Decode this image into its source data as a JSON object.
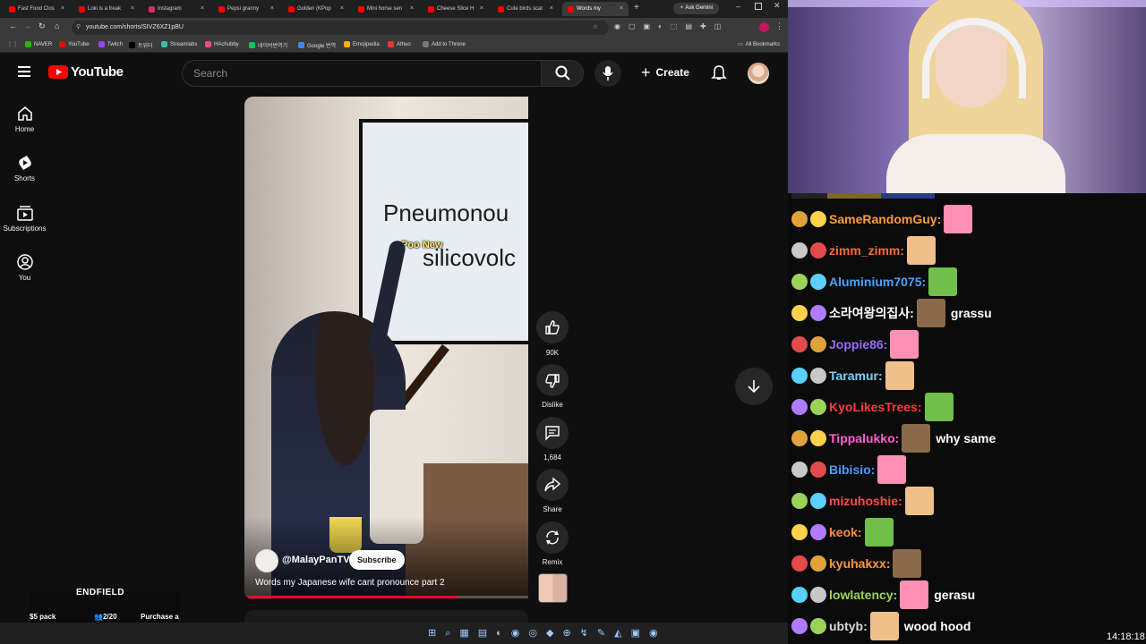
{
  "browser": {
    "tabs": [
      {
        "label": "Fast Food Clos",
        "color": "#ff0000"
      },
      {
        "label": "Loki is a freak",
        "color": "#ff0000"
      },
      {
        "label": "Instagram",
        "color": "#d62976"
      },
      {
        "label": "Pepsi granny",
        "color": "#ff0000"
      },
      {
        "label": "Golden (KPop",
        "color": "#ff0000"
      },
      {
        "label": "Mini horse sen",
        "color": "#ff0000"
      },
      {
        "label": "Cheese Slice H",
        "color": "#ff0000"
      },
      {
        "label": "Cute birds scar",
        "color": "#ff0000"
      },
      {
        "label": "Words my",
        "color": "#ff0000"
      }
    ],
    "ask_gemini": "Ask Gemini",
    "url": "youtube.com/shorts/SIVZ6XZ1pBU",
    "bookmarks": [
      "NAVER",
      "YouTube",
      "Twitch",
      "트위터",
      "Streamlabs",
      "HAchubby",
      "네이버번역기",
      "Google 번역",
      "Emojipedia",
      "Athuo",
      "Add to Throne"
    ],
    "all_bookmarks": "All Bookmarks"
  },
  "youtube": {
    "logo_text": "YouTube",
    "search_placeholder": "Search",
    "create_label": "Create",
    "sidebar": [
      {
        "label": "Home",
        "icon": "home-icon"
      },
      {
        "label": "Shorts",
        "icon": "shorts-icon"
      },
      {
        "label": "Subscriptions",
        "icon": "subscriptions-icon"
      },
      {
        "label": "You",
        "icon": "you-icon"
      }
    ],
    "short": {
      "board_line1": "Pneumonou",
      "board_line2": "silicovolc",
      "caption": "Poo New",
      "channel": "@MalayPanTV",
      "subscribe": "Subscribe",
      "title": "Words my Japanese wife cant pronounce part 2"
    },
    "actions": {
      "likes": "90K",
      "dislike": "Dislike",
      "comments": "1,684",
      "share": "Share",
      "remix": "Remix"
    }
  },
  "overlay": {
    "game_logo": "ENDFIELD",
    "pack": "$5 pack",
    "progress": "2/20",
    "purchase": "Purchase a"
  },
  "chat": [
    {
      "user": "SameRandomGuy:",
      "color": "#ff9a3c",
      "text": ""
    },
    {
      "user": "zimm_zimm:",
      "color": "#ff6a3c",
      "text": ""
    },
    {
      "user": "Aluminium7075:",
      "color": "#4aa3ff",
      "text": ""
    },
    {
      "user": "소라여왕의집사:",
      "color": "#ffffff",
      "text": "grassu"
    },
    {
      "user": "Joppie86:",
      "color": "#9b6bff",
      "text": ""
    },
    {
      "user": "Taramur:",
      "color": "#7ad0ff",
      "text": ""
    },
    {
      "user": "KyoLikesTrees:",
      "color": "#ff3b3b",
      "text": ""
    },
    {
      "user": "Tippalukko:",
      "color": "#ff5fd2",
      "text": "why same"
    },
    {
      "user": "Bibisio:",
      "color": "#4a9bff",
      "text": ""
    },
    {
      "user": "mizuhoshie:",
      "color": "#ff4a4a",
      "text": ""
    },
    {
      "user": "keok:",
      "color": "#ff8a3c",
      "text": ""
    },
    {
      "user": "kyuhakxx:",
      "color": "#ff9a3c",
      "text": ""
    },
    {
      "user": "lowlatency:",
      "color": "#9bd35a",
      "text": "gerasu"
    },
    {
      "user": "ubtyb:",
      "color": "#d9d9d9",
      "text": "wood hood"
    }
  ],
  "clock": "14:18:18"
}
